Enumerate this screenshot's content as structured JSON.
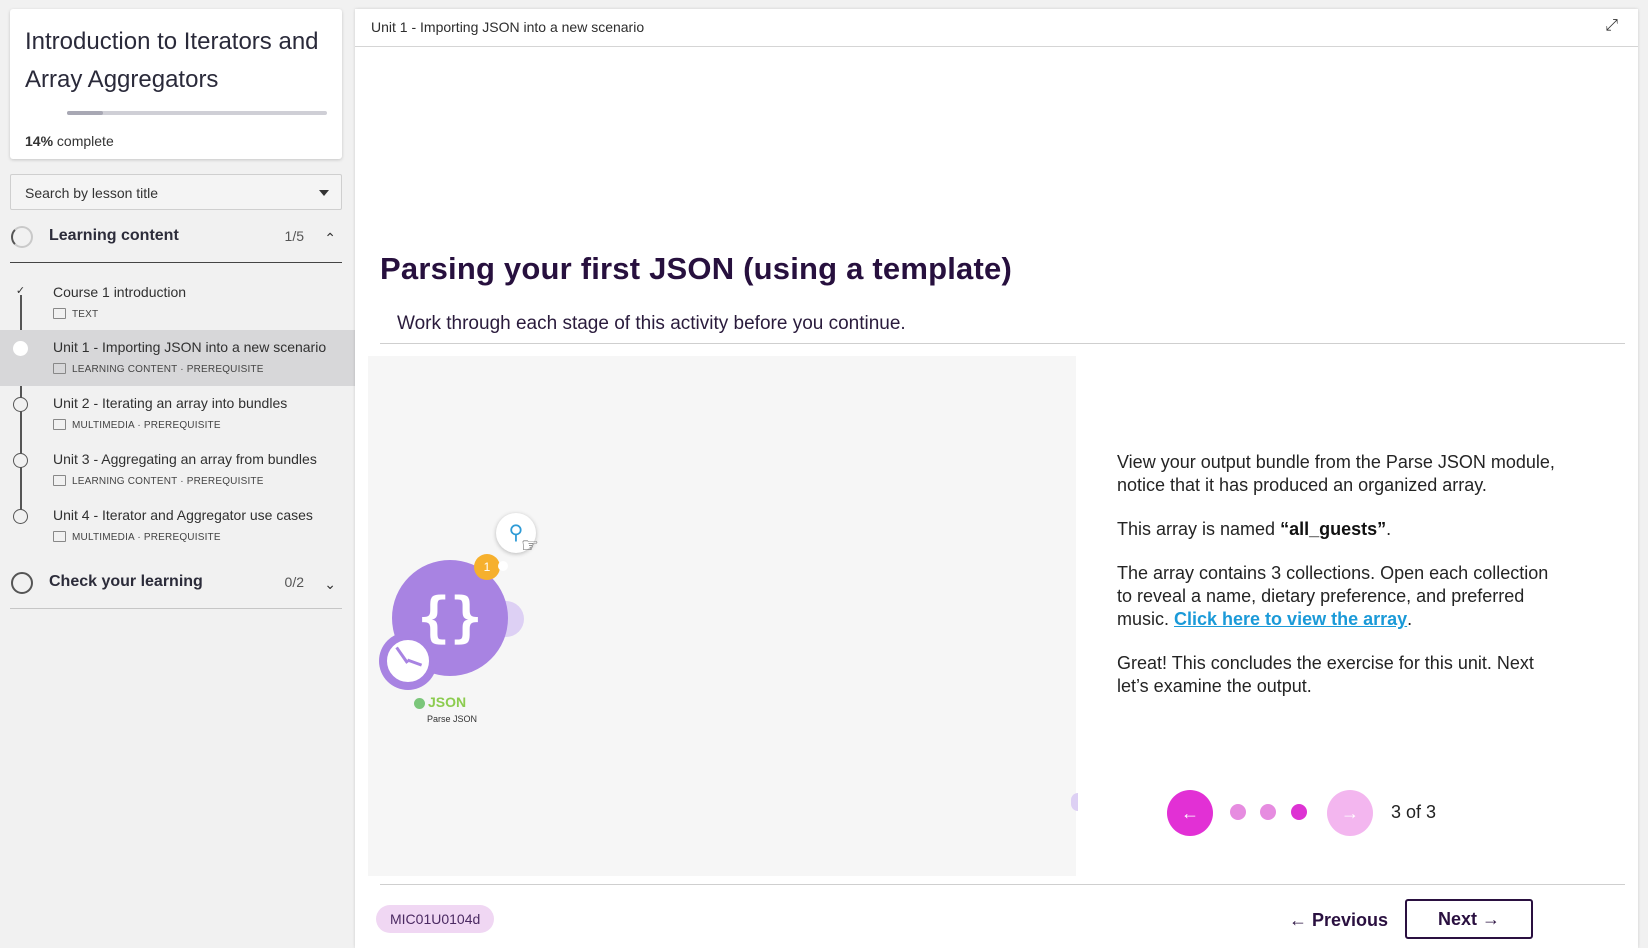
{
  "sidebar": {
    "course_title": "Introduction to Iterators and Array Aggregators",
    "progress": {
      "percent_label": "14%",
      "suffix": "complete",
      "value": 0.14
    },
    "search_placeholder": "Search by lesson title",
    "sections": [
      {
        "label": "Learning content",
        "count": "1/5",
        "chevron": "chevron-up-icon",
        "lessons": [
          {
            "title": "Course 1 introduction",
            "meta": "TEXT",
            "status": "done"
          },
          {
            "title": "Unit 1 - Importing JSON into a new scenario",
            "meta": "LEARNING CONTENT · PREREQUISITE",
            "status": "active"
          },
          {
            "title": "Unit 2 - Iterating an array into bundles",
            "meta": "MULTIMEDIA · PREREQUISITE",
            "status": "todo"
          },
          {
            "title": "Unit 3 - Aggregating an array from bundles",
            "meta": "LEARNING CONTENT · PREREQUISITE",
            "status": "todo"
          },
          {
            "title": "Unit 4 - Iterator and Aggregator use cases",
            "meta": "MULTIMEDIA · PREREQUISITE",
            "status": "todo"
          }
        ]
      },
      {
        "label": "Check your learning",
        "count": "0/2",
        "chevron": "chevron-down-icon"
      }
    ]
  },
  "main": {
    "breadcrumb": "Unit 1 - Importing JSON into a new scenario",
    "heading": "Parsing your first JSON (using a template)",
    "subheading": "Work through each stage of this activity before you continue.",
    "canvas": {
      "module_name": "JSON",
      "module_action": "Parse JSON",
      "badge": "1"
    },
    "explanation": {
      "p1": "View your output bundle from the Parse JSON module, notice that it has produced an organized array.",
      "p2_pre": "This array is named ",
      "p2_em": "“all_guests”",
      "p2_post": ".",
      "p3_pre": "The array contains 3 collections. Open each collection to reveal a name, dietary preference, and preferred music. ",
      "p3_link": "Click here to view the array",
      "p3_post": ".",
      "p4": "Great! This concludes the exercise for this unit. Next let’s examine the output."
    },
    "carousel": {
      "counter": "3 of 3",
      "current": 3,
      "total": 3
    },
    "footer": {
      "code": "MIC01U0104d",
      "previous_label": "← Previous",
      "next_label": "Next →"
    }
  },
  "colors": {
    "accent_magenta": "#e230d5",
    "heading_purple": "#27103e",
    "module_purple": "#a883e2",
    "link_blue": "#1b9ad8"
  }
}
